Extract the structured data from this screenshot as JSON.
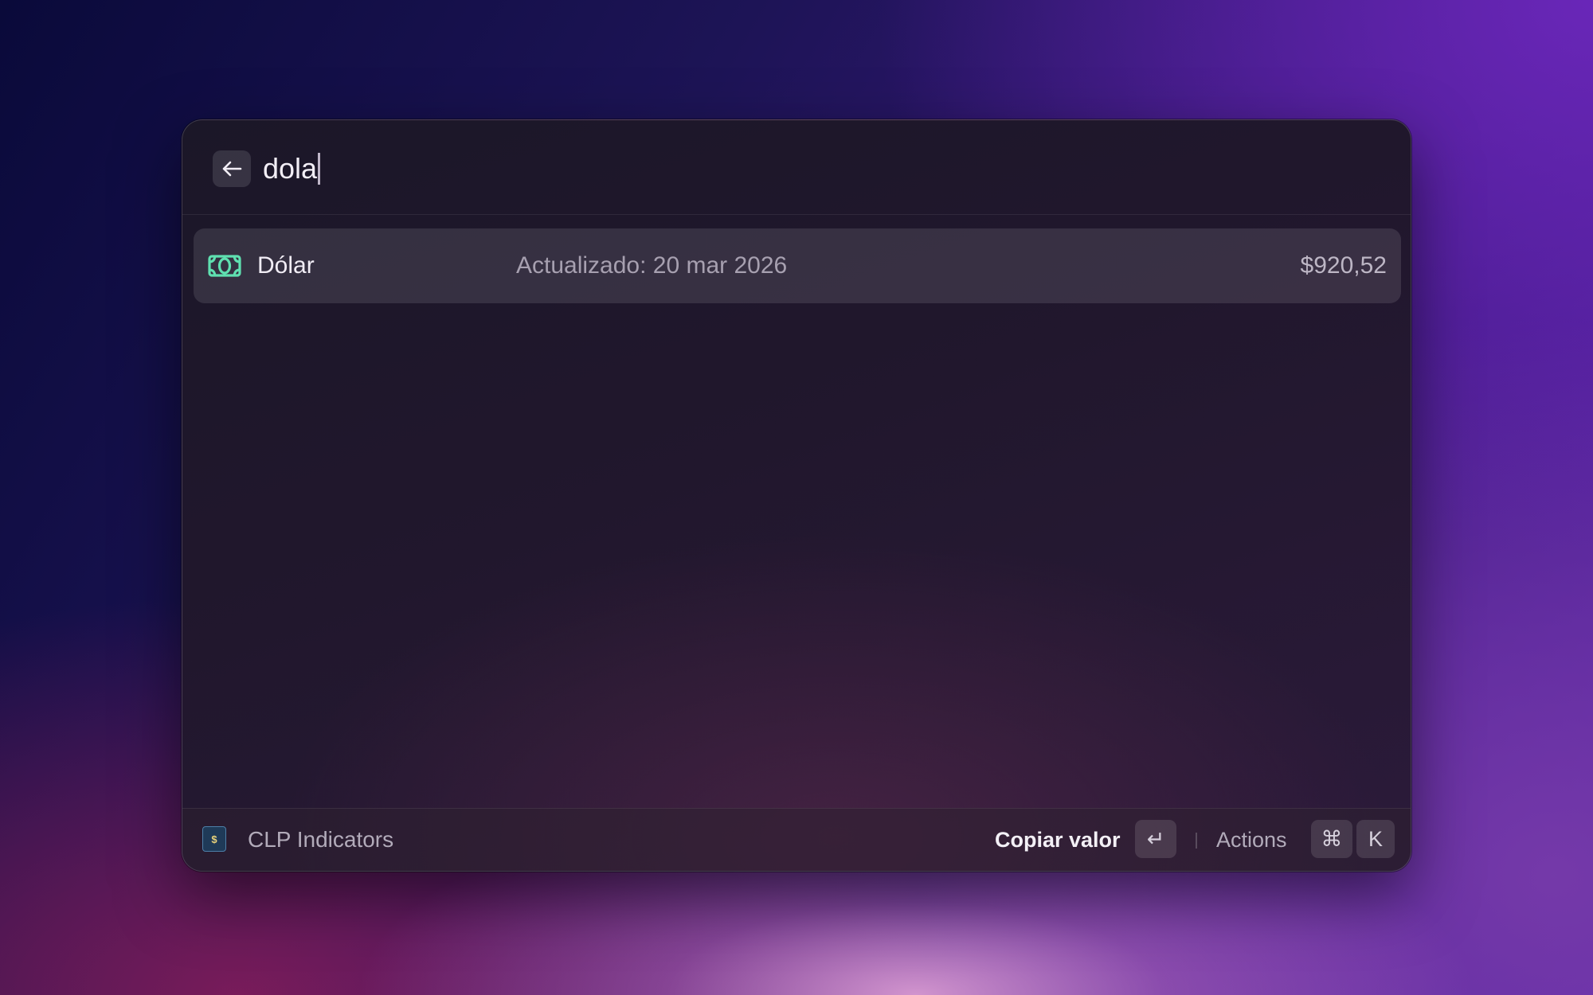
{
  "search": {
    "query": "dola"
  },
  "results": [
    {
      "icon": "banknote-icon",
      "title": "Dólar",
      "subtitle": "Actualizado: 20 mar 2026",
      "value": "$920,52"
    }
  ],
  "footer": {
    "extension_icon_text": "$",
    "extension_name": "CLP Indicators",
    "primary_action": "Copiar valor",
    "enter_key": "↵",
    "actions_label": "Actions",
    "cmd_key": "⌘",
    "k_key": "K"
  },
  "colors": {
    "accent_icon": "#5fe0b0",
    "window_bg": "#1e1729"
  }
}
